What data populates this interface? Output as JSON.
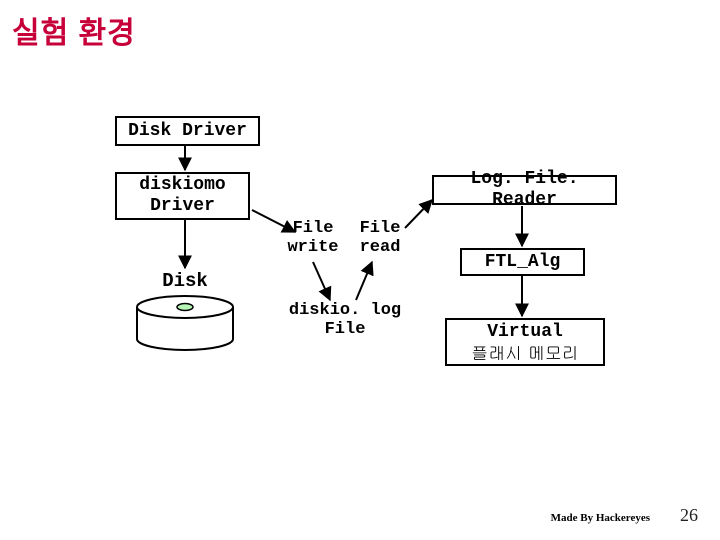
{
  "title": "실험 환경",
  "boxes": {
    "disk_driver": "Disk Driver",
    "diskiomo_driver": "diskiomo\nDriver",
    "logfile_reader": "Log. File. Reader",
    "ftl_alg": "FTL_Alg",
    "virtual_flash_l1": "Virtual",
    "virtual_flash_l2": "플래시 메모리"
  },
  "labels": {
    "disk": "Disk",
    "file_write": "File\nwrite",
    "file_read": "File\nread",
    "diskio_log_file": "diskio. log\nFile"
  },
  "footer": "Made By Hackereyes",
  "page_number": "26"
}
